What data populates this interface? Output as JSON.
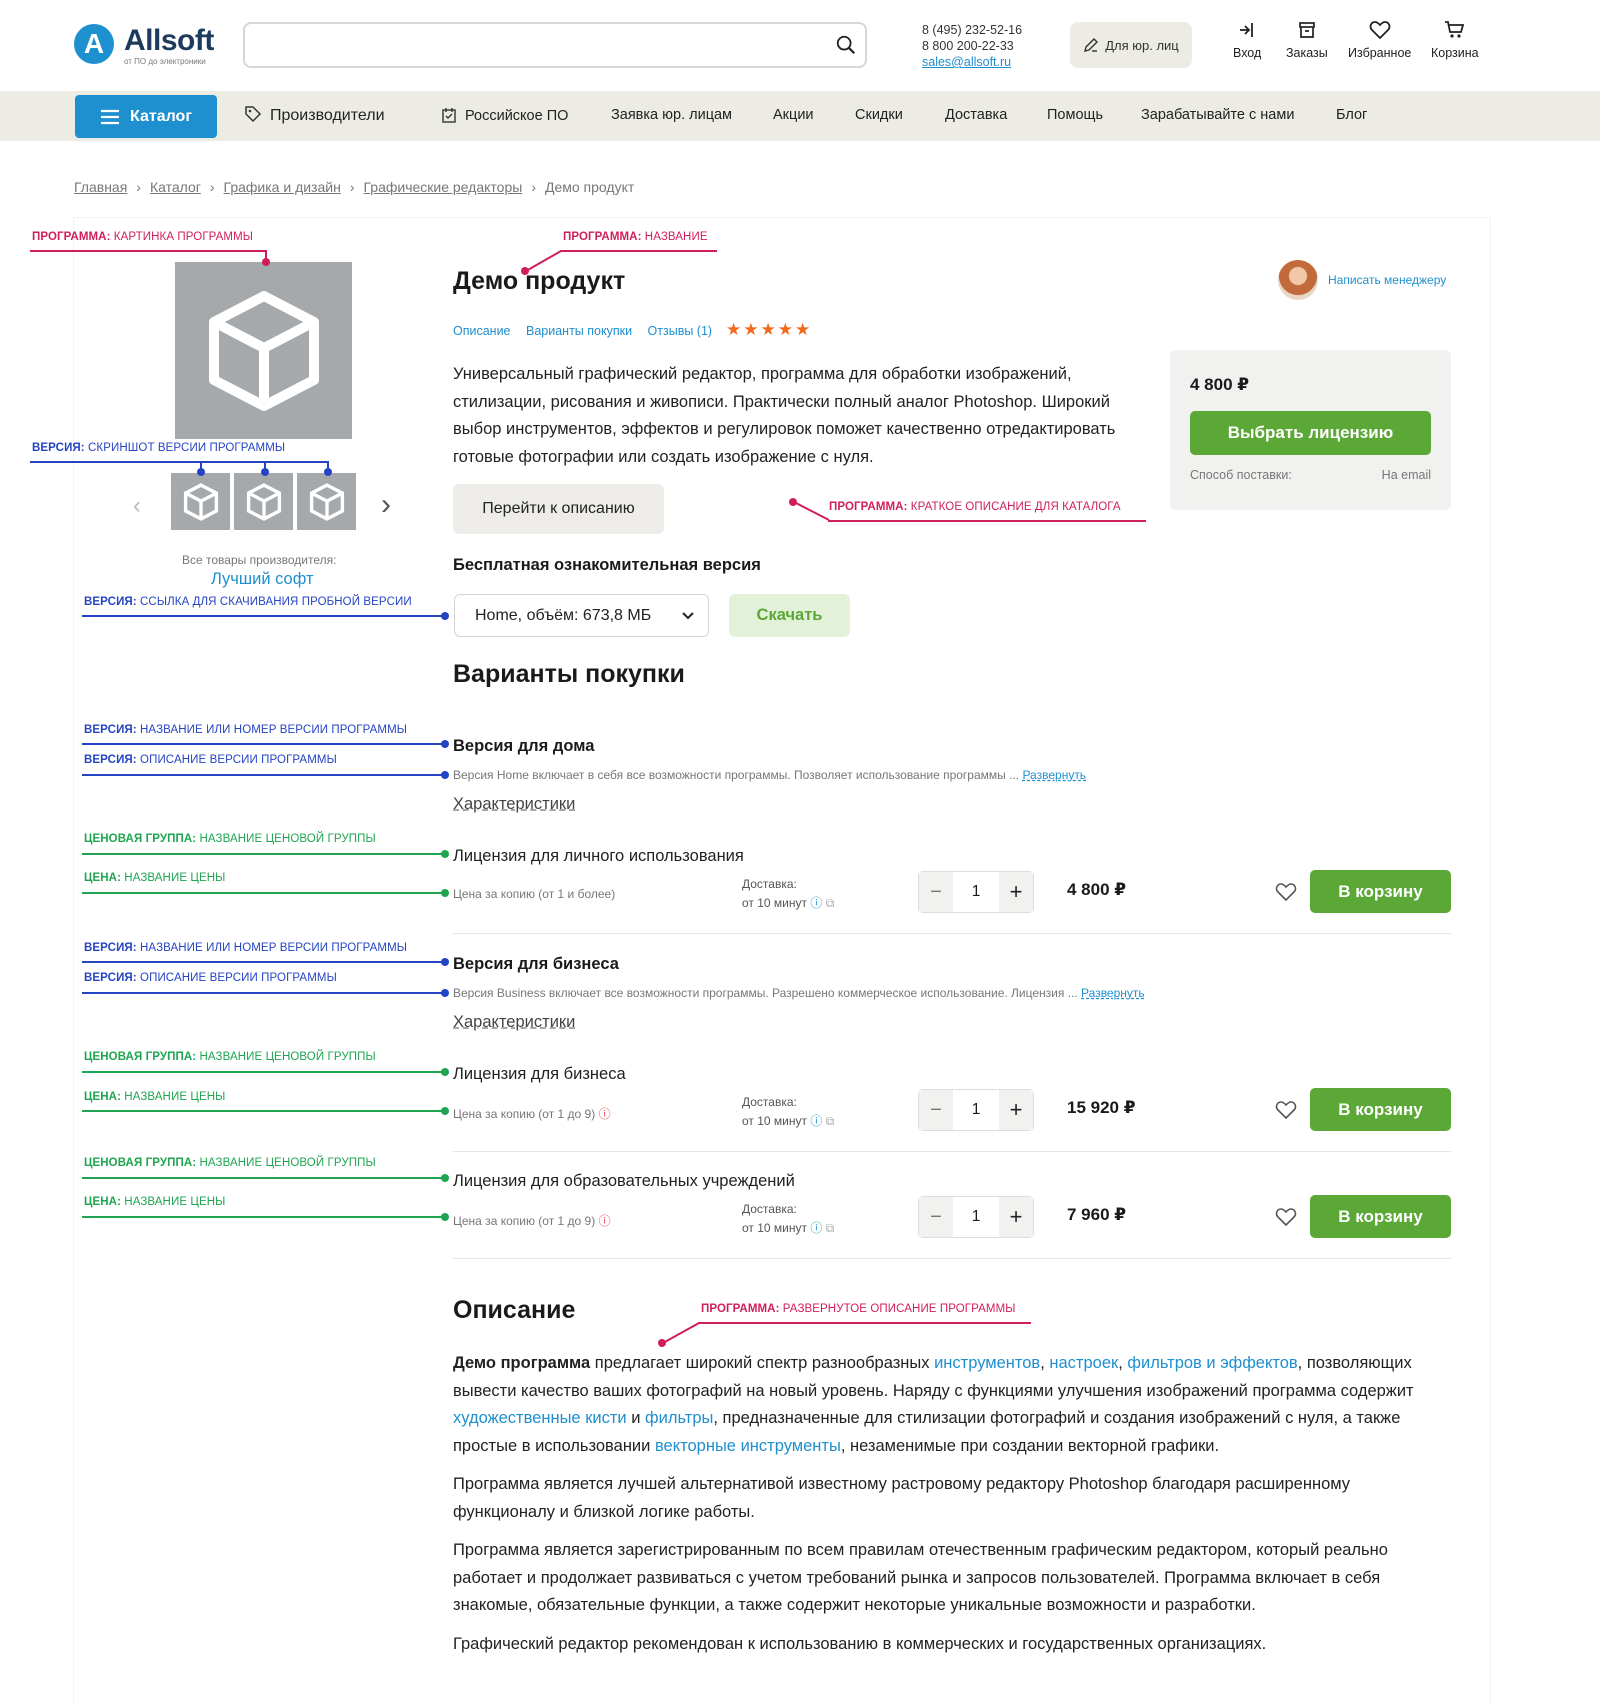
{
  "header": {
    "logo_letter": "A",
    "logo_name": "Allsoft",
    "logo_tagline": "от ПО до электроники",
    "search_placeholder": "",
    "phone1": "8 (495) 232-52-16",
    "phone2": "8 800 200-22-33",
    "email": "sales@allsoft.ru",
    "corp_button": "Для юр. лиц",
    "icons": [
      {
        "label": "Вход",
        "icon": "login-icon"
      },
      {
        "label": "Заказы",
        "icon": "orders-icon"
      },
      {
        "label": "Избранное",
        "icon": "heart-icon"
      },
      {
        "label": "Корзина",
        "icon": "cart-icon"
      }
    ]
  },
  "nav": {
    "catalog": "Каталог",
    "items": [
      "Производители",
      "Российское ПО",
      "Заявка юр. лицам",
      "Акции",
      "Скидки",
      "Доставка",
      "Помощь",
      "Зарабатывайте с нами",
      "Блог"
    ]
  },
  "breadcrumbs": [
    "Главная",
    "Каталог",
    "Графика и дизайн",
    "Графические редакторы",
    "Демо продукт"
  ],
  "annotations": {
    "program_image": {
      "b": "ПРОГРАММА:",
      "t": " КАРТИНКА ПРОГРАММЫ"
    },
    "program_name": {
      "b": "ПРОГРАММА:",
      "t": " НАЗВАНИЕ"
    },
    "version_screenshot": {
      "b": "ВЕРСИЯ:",
      "t": " СКРИНШОТ ВЕРСИИ ПРОГРАММЫ"
    },
    "version_trial_link": {
      "b": "ВЕРСИЯ:",
      "t": " ССЫЛКА ДЛЯ СКАЧИВАНИЯ ПРОБНОЙ ВЕРСИИ"
    },
    "program_short_desc": {
      "b": "ПРОГРАММА:",
      "t": "  КРАТКОЕ ОПИСАНИЕ ДЛЯ КАТАЛОГА"
    },
    "version_name": {
      "b": "ВЕРСИЯ:",
      "t": " НАЗВАНИЕ ИЛИ НОМЕР ВЕРСИИ ПРОГРАММЫ"
    },
    "version_desc": {
      "b": "ВЕРСИЯ:",
      "t": " ОПИСАНИЕ ВЕРСИИ ПРОГРАММЫ"
    },
    "price_group": {
      "b": "ЦЕНОВАЯ ГРУППА:",
      "t": " НАЗВАНИЕ ЦЕНОВОЙ ГРУППЫ"
    },
    "price_name": {
      "b": "ЦЕНА:",
      "t": " НАЗВАНИЕ ЦЕНЫ"
    },
    "program_full_desc": {
      "b": "ПРОГРАММА:",
      "t": " РАЗВЕРНУТОЕ ОПИСАНИЕ ПРОГРАММЫ"
    }
  },
  "product": {
    "title": "Демо продукт",
    "tabs": [
      "Описание",
      "Варианты покупки",
      "Отзывы (1)"
    ],
    "rating": 5,
    "stars": "★★★★★",
    "short_desc": "Универсальный графический редактор, программа для обработки изображений, стилизации, рисования и живописи. Практически полный аналог Photoshop. Широкий выбор инструментов, эффектов и регулировок поможет качественно отредактировать готовые фотографии или создать изображение с нуля.",
    "goto_desc": "Перейти к описанию",
    "manager_link": "Написать менеджеру",
    "vendor_label": "Все товары производителя:",
    "vendor_name": "Лучший софт",
    "price": "4 800 ₽",
    "choose_license": "Выбрать лицензию",
    "delivery_label": "Способ поставки:",
    "delivery_value": "На email",
    "free_title": "Бесплатная ознакомительная версия",
    "free_select": "Home, объём: 673,8 МБ",
    "download": "Скачать"
  },
  "purchase": {
    "title": "Варианты покупки",
    "characteristics": "Характеристики",
    "expand": "Развернуть",
    "delivery_label": "Доставка:",
    "delivery_time": "от 10 минут",
    "to_cart": "В корзину",
    "versions": [
      {
        "name": "Версия для дома",
        "desc": "Версия Home включает в себя все возможности программы.  Позволяет  использование программы ...",
        "groups": [
          {
            "name": "Лицензия для личного использования",
            "price_name": "Цена за копию (от 1 и более)",
            "qty": "1",
            "price": "4 800 ₽"
          }
        ]
      },
      {
        "name": "Версия для бизнеса",
        "desc": "Версия Business включает все возможности программы. Разрешено коммерческое использование. Лицензия ...",
        "groups": [
          {
            "name": "Лицензия для бизнеса",
            "price_name": "Цена за копию (от 1 до 9)",
            "qty": "1",
            "price": "15 920 ₽"
          },
          {
            "name": "Лицензия для образовательных учреждений",
            "price_name": "Цена за копию (от 1 до 9)",
            "qty": "1",
            "price": "7 960 ₽"
          }
        ]
      }
    ]
  },
  "description": {
    "title": "Описание",
    "p1": {
      "strong": "Демо программа",
      "t1": " предлагает широкий спектр разнообразных ",
      "l1": "инструментов",
      "t2": ", ",
      "l2": "настроек",
      "t3": ", ",
      "l3": "фильтров и эффектов",
      "t4": ", позволяющих вывести качество ваших фотографий на новый уровень. Наряду с функциями улучшения изображений программа содержит ",
      "l4": "художественные кисти",
      "t5": " и ",
      "l5": "фильтры",
      "t6": ", предназначенные для стилизации фотографий и создания изображений с нуля, а также простые в использовании ",
      "l6": "векторные инструменты",
      "t7": ", незаменимые при создании векторной графики."
    },
    "p2": "Программа является лучшей альтернативой известному растровому редактору Photoshop благодаря расширенному функционалу и близкой логике работы.",
    "p3": "Программа является зарегистрированным по всем правилам отечественным графическим редактором, который реально работает и продолжает развиваться с учетом требований рынка и запросов пользователей. Программа включает в себя знакомые, обязательные функции, а также содержит некоторые уникальные возможности и разработки.",
    "p4": "Графический редактор  рекомендован к использованию в коммерческих и государственных организациях."
  },
  "colors": {
    "brand_blue": "#1e8fcf",
    "green": "#5ca837",
    "ann_red": "#d01f58",
    "ann_blue": "#2544c4",
    "ann_green": "#1fa551",
    "nav_bg": "#edece4"
  }
}
